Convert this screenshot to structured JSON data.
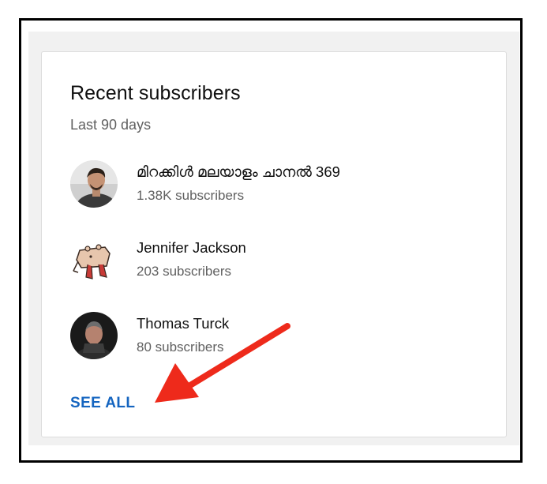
{
  "card": {
    "title": "Recent subscribers",
    "subtitle": "Last 90 days",
    "see_all_label": "SEE ALL"
  },
  "subscribers": [
    {
      "name": "മിറക്കിൾ മലയാളം ചാനൽ 369",
      "count": "1.38K subscribers",
      "avatar": "person-photo-avatar"
    },
    {
      "name": "Jennifer Jackson",
      "count": "203 subscribers",
      "avatar": "cartoon-creature-avatar"
    },
    {
      "name": "Thomas Turck",
      "count": "80 subscribers",
      "avatar": "person-photo-avatar"
    }
  ],
  "colors": {
    "link": "#1565c0",
    "annotation_arrow": "#ee2a1b",
    "background": "#f1f1f1"
  }
}
